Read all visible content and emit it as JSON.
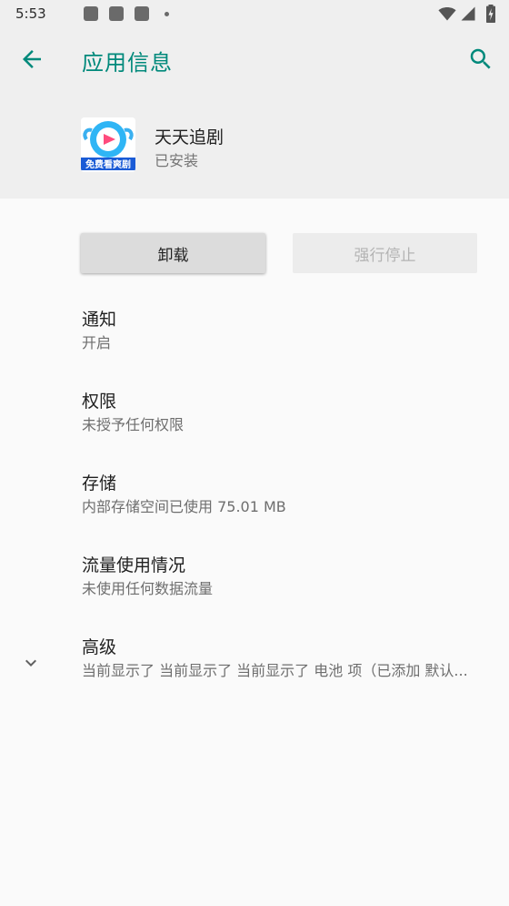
{
  "status_bar": {
    "time": "5:53"
  },
  "app_bar": {
    "title": "应用信息"
  },
  "app": {
    "name": "天天追剧",
    "status": "已安装",
    "icon_banner_text": "免费看爽剧"
  },
  "buttons": {
    "uninstall": "卸载",
    "force_stop": "强行停止"
  },
  "preferences": [
    {
      "title": "通知",
      "summary": "开启"
    },
    {
      "title": "权限",
      "summary": "未授予任何权限"
    },
    {
      "title": "存储",
      "summary": "内部存储空间已使用 75.01 MB"
    },
    {
      "title": "流量使用情况",
      "summary": "未使用任何数据流量"
    },
    {
      "title": "高级",
      "summary": "当前显示了 当前显示了 当前显示了 电池 项（已添加 默认..."
    }
  ],
  "colors": {
    "accent": "#00897b",
    "background": "#fafafa",
    "header": "#efefef"
  },
  "icons": [
    "back-arrow",
    "search",
    "chevron-down",
    "wifi",
    "signal",
    "battery"
  ]
}
